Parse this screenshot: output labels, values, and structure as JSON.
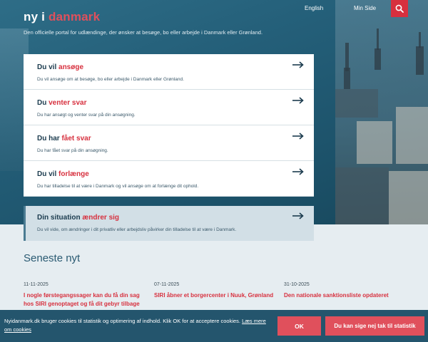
{
  "header": {
    "logo_part1": "ny i ",
    "logo_part2": "danmark",
    "tagline": "Den officielle portal for udlændinge, der ønsker at besøge, bo eller arbejde i Danmark eller Grønland.",
    "nav_english": "English",
    "nav_min_side": "Min Side",
    "search_icon": "search-icon"
  },
  "cards": [
    {
      "prefix": "Du vil ",
      "highlight": "ansøge",
      "desc": "Du vil ansøge om at besøge, bo eller arbejde i Danmark eller Grønland.",
      "icon": "arrow-right-icon"
    },
    {
      "prefix": "Du ",
      "highlight": "venter svar",
      "desc": "Du har ansøgt og venter svar på din ansøgning.",
      "icon": "arrow-right-icon"
    },
    {
      "prefix": "Du har ",
      "highlight": "fået svar",
      "desc": "Du har fået svar på din ansøgning.",
      "icon": "arrow-right-icon"
    },
    {
      "prefix": "Du vil ",
      "highlight": "forlænge",
      "desc": "Du har tilladelse til at være i Danmark og vil ansøge om at forlænge dit ophold.",
      "icon": "arrow-right-icon"
    }
  ],
  "situation_card": {
    "prefix": "Din situation ",
    "highlight": "ændrer sig",
    "desc": "Du vil vide, om ændringer i dit privatliv eller arbejdsliv påvirker din tilladelse til at være i Danmark.",
    "icon": "arrow-right-icon"
  },
  "news": {
    "heading": "Seneste nyt",
    "items": [
      {
        "date": "11-11-2025",
        "headline": "I nogle førstegangssager kan du få din sag hos SIRI genoptaget og få dit gebyr tilbage"
      },
      {
        "date": "07-11-2025",
        "headline": "SIRI åbner et borgercenter i Nuuk, Grønland"
      },
      {
        "date": "31-10-2025",
        "headline": "Den nationale sanktionsliste opdateret"
      }
    ]
  },
  "cookie": {
    "text": "Nyidanmark.dk bruger cookies til statistik og optimering af indhold. Klik OK for at acceptere cookies. ",
    "link": "Læs mere om cookies",
    "ok_label": "OK",
    "decline_label": "Du kan sige nej tak til statistik"
  },
  "colors": {
    "accent_red": "#d7303e",
    "hero_blue": "#245f79",
    "cookie_bar": "#24556d"
  }
}
